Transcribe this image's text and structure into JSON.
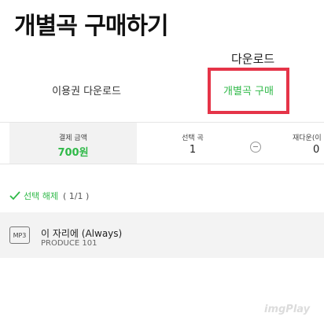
{
  "header": {
    "title": "개별곡 구매하기"
  },
  "download_heading": "다운로드",
  "tabs": [
    {
      "label": "이용권 다운로드"
    },
    {
      "label": "개별곡 구매"
    }
  ],
  "summary": {
    "payment": {
      "label": "결제 금액",
      "value": "700원"
    },
    "selected": {
      "label": "선택 곡",
      "value": "1"
    },
    "redownload": {
      "label": "재다운(이",
      "value": "0"
    }
  },
  "selection": {
    "deselect_label": "선택 해제",
    "count": "( 1/1 )"
  },
  "track": {
    "badge": "MP3",
    "title": "이 자리에 (Always)",
    "artist": "PRODUCE 101"
  },
  "watermark": "imgPlay",
  "colors": {
    "accent": "#2fb948",
    "highlight": "#e53448"
  }
}
